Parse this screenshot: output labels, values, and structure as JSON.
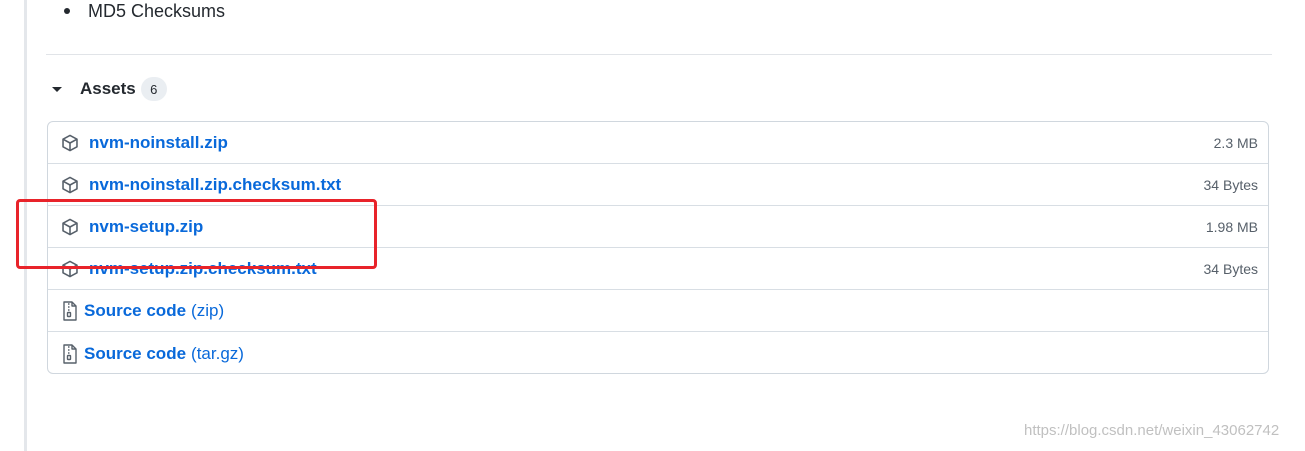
{
  "bullet": {
    "text": "MD5 Checksums"
  },
  "assets": {
    "title": "Assets",
    "count": "6",
    "items": [
      {
        "name": "nvm-noinstall.zip",
        "size": "2.3 MB",
        "icon": "package-icon"
      },
      {
        "name": "nvm-noinstall.zip.checksum.txt",
        "size": "34 Bytes",
        "icon": "package-icon"
      },
      {
        "name": "nvm-setup.zip",
        "size": "1.98 MB",
        "icon": "package-icon"
      },
      {
        "name": "nvm-setup.zip.checksum.txt",
        "size": "34 Bytes",
        "icon": "package-icon"
      },
      {
        "name": "Source code",
        "suffix": "(zip)",
        "icon": "file-zip-icon"
      },
      {
        "name": "Source code",
        "suffix": "(tar.gz)",
        "icon": "file-zip-icon"
      }
    ]
  },
  "watermark": {
    "text": "https://blog.csdn.net/weixin_43062742"
  },
  "colors": {
    "link": "#0969da",
    "annotation": "#e8232a",
    "border": "#d0d7de"
  }
}
